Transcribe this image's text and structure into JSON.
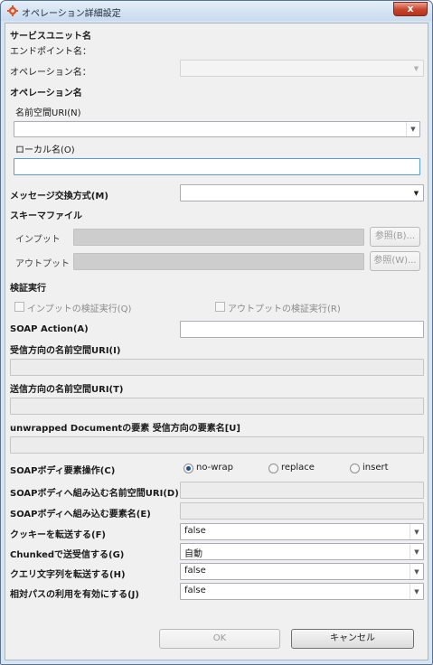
{
  "window": {
    "title": "オペレーション詳細設定",
    "close_glyph": "x"
  },
  "service_unit": {
    "heading": "サービスユニット名",
    "endpoint_label": "エンドポイント名：",
    "operation_label": "オペレーション名：",
    "operation_value": ""
  },
  "operation": {
    "heading": "オペレーション名",
    "namespace_label": "名前空間URI(N)",
    "namespace_value": "",
    "local_name_label": "ローカル名(O)",
    "local_name_value": ""
  },
  "message_exchange": {
    "label": "メッセージ交換方式(M)",
    "value": ""
  },
  "schema": {
    "heading": "スキーマファイル",
    "input_label": "インプット",
    "input_value": "",
    "input_browse": "参照(B)...",
    "output_label": "アウトプット",
    "output_value": "",
    "output_browse": "参照(W)..."
  },
  "validation": {
    "heading": "検証実行",
    "input_check": "インプットの検証実行(Q)",
    "output_check": "アウトプットの検証実行(R)"
  },
  "soap_action": {
    "label": "SOAP Action(A)",
    "value": ""
  },
  "recv_ns": {
    "label": "受信方向の名前空間URI(I)",
    "value": ""
  },
  "send_ns": {
    "label": "送信方向の名前空間URI(T)",
    "value": ""
  },
  "unwrapped": {
    "label": "unwrapped Documentの要素 受信方向の要素名[U]",
    "value": ""
  },
  "soap_body_op": {
    "label": "SOAPボディ要素操作(C)",
    "options": [
      "no-wrap",
      "replace",
      "insert"
    ],
    "selected": "no-wrap"
  },
  "soap_body_ns": {
    "label": "SOAPボディへ組み込む名前空間URI(D)",
    "value": ""
  },
  "soap_body_elem": {
    "label": "SOAPボディへ組み込む要素名(E)",
    "value": ""
  },
  "cookie": {
    "label": "クッキーを転送する(F)",
    "value": "false"
  },
  "chunked": {
    "label": "Chunkedで送受信する(G)",
    "value": "自動"
  },
  "query": {
    "label": "クエリ文字列を転送する(H)",
    "value": "false"
  },
  "relative_path": {
    "label": "相対パスの利用を有効にする(J)",
    "value": "false"
  },
  "buttons": {
    "ok": "OK",
    "cancel": "キャンセル"
  },
  "icons": {
    "app": "gear-icon",
    "dropdown": "chevron-down-icon",
    "close": "close-icon"
  }
}
